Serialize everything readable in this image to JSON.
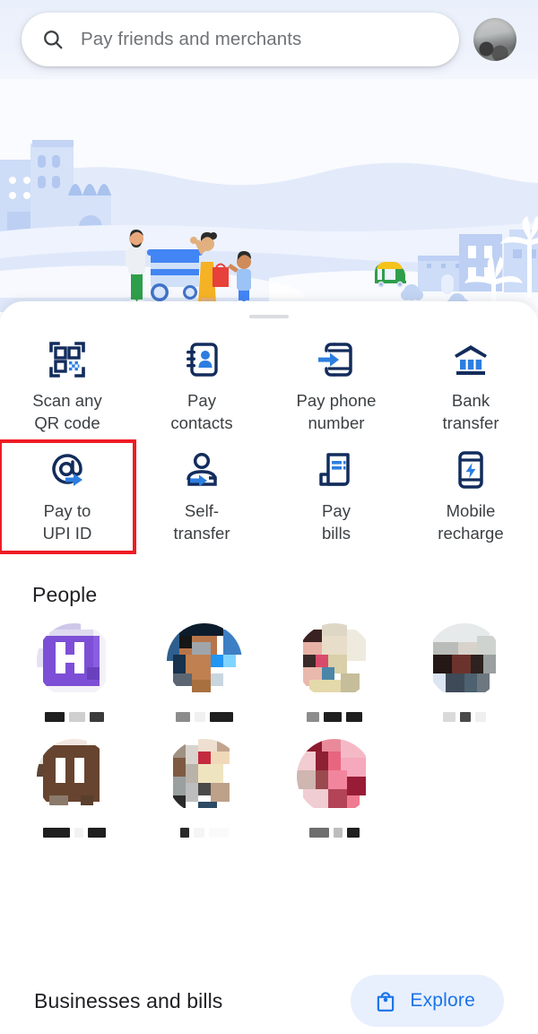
{
  "colors": {
    "navy": "#122c5c",
    "blue": "#1a73e8",
    "accent_red": "#ef1c25",
    "chip_bg": "#e8f0fe",
    "text_primary": "#202124",
    "text_secondary": "#3c4043",
    "placeholder": "#6f7276"
  },
  "header": {
    "search": {
      "placeholder": "Pay friends and merchants",
      "icon": "search-icon"
    },
    "avatar": {
      "icon": "user-avatar"
    }
  },
  "hero": {
    "illustration": "city-street-scene-illustration"
  },
  "sheet": {
    "grabber": "drag-handle",
    "actions": [
      {
        "label": "Scan any\nQR code",
        "icon": "qr-code-icon",
        "highlighted": false
      },
      {
        "label": "Pay\ncontacts",
        "icon": "contact-book-icon",
        "highlighted": false
      },
      {
        "label": "Pay phone\nnumber",
        "icon": "phone-arrow-icon",
        "highlighted": false
      },
      {
        "label": "Bank\ntransfer",
        "icon": "bank-icon",
        "highlighted": false
      },
      {
        "label": "Pay to\nUPI ID",
        "icon": "at-sign-arrow-icon",
        "highlighted": true
      },
      {
        "label": "Self-\ntransfer",
        "icon": "person-arrow-icon",
        "highlighted": false
      },
      {
        "label": "Pay\nbills",
        "icon": "invoice-icon",
        "highlighted": false
      },
      {
        "label": "Mobile\nrecharge",
        "icon": "phone-bolt-icon",
        "highlighted": false
      }
    ],
    "people": {
      "title": "People",
      "items": [
        {
          "name_redacted": true,
          "avatar_kind": "monogram-purple",
          "monogram": "H"
        },
        {
          "name_redacted": true,
          "avatar_kind": "photo-blurred-blue"
        },
        {
          "name_redacted": true,
          "avatar_kind": "photo-blurred-cream"
        },
        {
          "name_redacted": true,
          "avatar_kind": "photo-blurred-grey"
        },
        {
          "name_redacted": true,
          "avatar_kind": "photo-blurred-brown"
        },
        {
          "name_redacted": true,
          "avatar_kind": "photo-blurred-tan"
        },
        {
          "name_redacted": true,
          "avatar_kind": "photo-blurred-pink"
        }
      ]
    },
    "businesses": {
      "title": "Businesses and bills",
      "explore_label": "Explore",
      "explore_icon": "shopping-bag-icon"
    }
  }
}
